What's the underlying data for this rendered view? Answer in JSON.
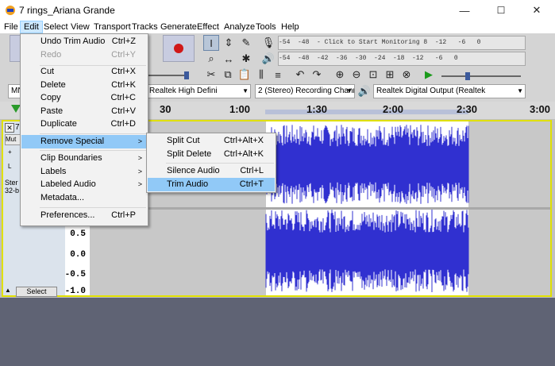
{
  "window": {
    "title": "7 rings_Ariana Grande",
    "minimize": "—",
    "maximize": "☐",
    "close": "✕"
  },
  "menubar": [
    "File",
    "Edit",
    "Select",
    "View",
    "Transport",
    "Tracks",
    "Generate",
    "Effect",
    "Analyze",
    "Tools",
    "Help"
  ],
  "meters": {
    "record": "-54  -48  - Click to Start Monitoring 8  -12   -6   0",
    "playback": "-54  -48  -42  -36  -30  -24  -18  -12   -6   0"
  },
  "devices": {
    "host_partial": "MN",
    "recording_device": "Realtek High Defini",
    "channels": "2 (Stereo) Recording Chann",
    "playback_device": "Realtek Digital Output (Realtek"
  },
  "ruler": {
    "labels": [
      "30",
      "1:00",
      "1:30",
      "2:00",
      "2:30",
      "3:00"
    ]
  },
  "track": {
    "name_partial": "7",
    "mute_partial": "Mut",
    "pan_partial": "L",
    "channel_partial": "Ster",
    "bits_partial": "32-b",
    "select_label": "Select",
    "scale": [
      "0.5",
      "0.0",
      "-0.5",
      "-1.0"
    ]
  },
  "edit_menu": {
    "items": [
      {
        "label": "Undo Trim Audio",
        "accel": "Ctrl+Z"
      },
      {
        "label": "Redo",
        "accel": "Ctrl+Y"
      },
      {
        "label": "Cut",
        "accel": "Ctrl+X"
      },
      {
        "label": "Delete",
        "accel": "Ctrl+K"
      },
      {
        "label": "Copy",
        "accel": "Ctrl+C"
      },
      {
        "label": "Paste",
        "accel": "Ctrl+V"
      },
      {
        "label": "Duplicate",
        "accel": "Ctrl+D"
      },
      {
        "label": "Remove Special",
        "accel": ""
      },
      {
        "label": "Clip Boundaries",
        "accel": ""
      },
      {
        "label": "Labels",
        "accel": ""
      },
      {
        "label": "Labeled Audio",
        "accel": ""
      },
      {
        "label": "Metadata...",
        "accel": ""
      },
      {
        "label": "Preferences...",
        "accel": "Ctrl+P"
      }
    ]
  },
  "remove_special_menu": {
    "items": [
      {
        "label": "Split Cut",
        "accel": "Ctrl+Alt+X"
      },
      {
        "label": "Split Delete",
        "accel": "Ctrl+Alt+K"
      },
      {
        "label": "Silence Audio",
        "accel": "Ctrl+L"
      },
      {
        "label": "Trim Audio",
        "accel": "Ctrl+T"
      }
    ]
  },
  "colors": {
    "wave": "#3030d0",
    "menu_highlight": "#91c9f7",
    "track_border": "#e0e000",
    "background": "#5f6374"
  }
}
